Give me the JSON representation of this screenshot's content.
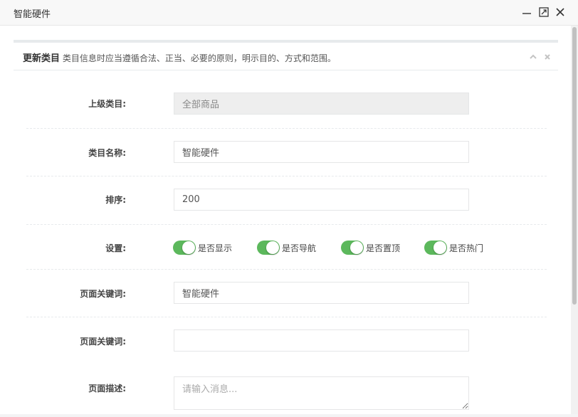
{
  "window": {
    "title": "智能硬件"
  },
  "panel": {
    "heading": "更新类目",
    "description": "类目信息时应当遵循合法、正当、必要的原则，明示目的、方式和范围。"
  },
  "form": {
    "parent_category": {
      "label": "上级类目:",
      "value": "全部商品"
    },
    "category_name": {
      "label": "类目名称:",
      "value": "智能硬件"
    },
    "sort_order": {
      "label": "排序:",
      "value": "200"
    },
    "settings": {
      "label": "设置:",
      "switches": [
        {
          "label": "是否显示",
          "on": true
        },
        {
          "label": "是否导航",
          "on": true
        },
        {
          "label": "是否置顶",
          "on": true
        },
        {
          "label": "是否热门",
          "on": true
        }
      ]
    },
    "page_keywords": {
      "label": "页面关键词:",
      "value": "智能硬件"
    },
    "page_keywords_2": {
      "label": "页面关键词:",
      "value": ""
    },
    "page_description": {
      "label": "页面描述:",
      "placeholder": "请输入消息..."
    }
  },
  "colors": {
    "switch_on": "#5cb85c",
    "readonly_bg": "#eeeeee"
  }
}
